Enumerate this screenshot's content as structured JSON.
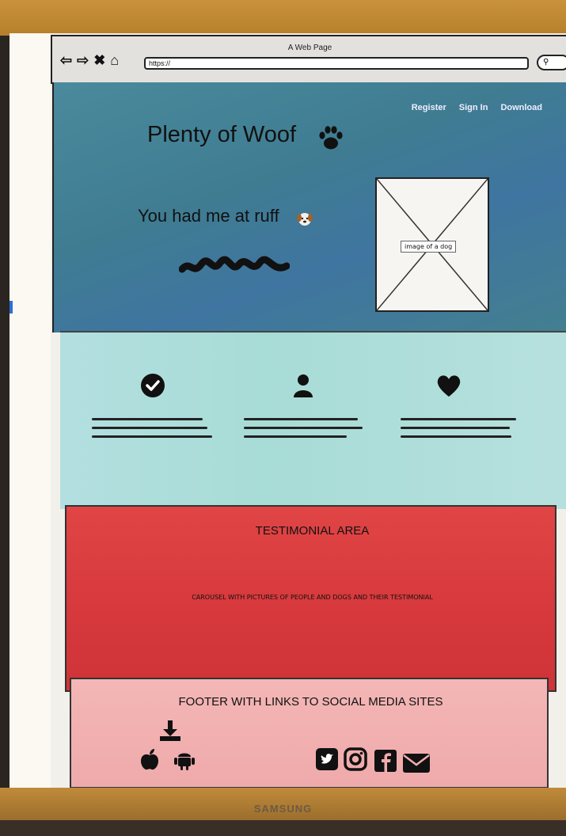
{
  "browser": {
    "title": "A Web Page",
    "url": "https://"
  },
  "nav": {
    "register": "Register",
    "sign_in": "Sign In",
    "download": "Download"
  },
  "hero": {
    "logo": "Plenty of Woof",
    "tagline": "You had me at ruff",
    "image_placeholder": "image of a dog"
  },
  "features": {
    "items": [
      {
        "icon": "check-circle-icon"
      },
      {
        "icon": "user-icon"
      },
      {
        "icon": "heart-icon"
      }
    ]
  },
  "testimonial": {
    "title": "TESTIMONIAL AREA",
    "description": "CAROUSEL WITH PICTURES OF PEOPLE AND DOGS AND THEIR TESTIMONIAL"
  },
  "footer": {
    "title": "FOOTER WITH LINKS TO SOCIAL MEDIA SITES",
    "icons": [
      "download-icon",
      "apple-icon",
      "android-icon",
      "twitter-icon",
      "instagram-icon",
      "facebook-icon",
      "mail-icon"
    ]
  },
  "monitor": {
    "brand": "SAMSUNG"
  }
}
